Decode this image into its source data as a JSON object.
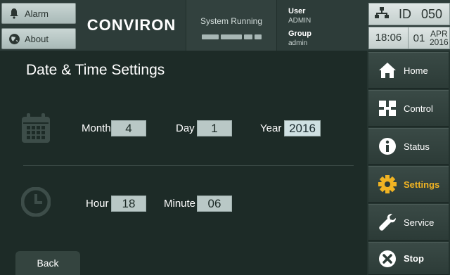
{
  "header": {
    "alarm_label": "Alarm",
    "about_label": "About",
    "brand": "CONVIRON",
    "system_status": "System Running",
    "user_label": "User",
    "user_value": "ADMIN",
    "group_label": "Group",
    "group_value": "admin",
    "id_label": "ID",
    "id_value": "050",
    "time": "18:06",
    "date_day": "01",
    "date_month": "APR",
    "date_year": "2016"
  },
  "main": {
    "title": "Date & Time Settings",
    "date": {
      "month_label": "Month",
      "month_value": "4",
      "day_label": "Day",
      "day_value": "1",
      "year_label": "Year",
      "year_value": "2016"
    },
    "time": {
      "hour_label": "Hour",
      "hour_value": "18",
      "minute_label": "Minute",
      "minute_value": "06"
    },
    "back_label": "Back"
  },
  "nav": {
    "items": [
      {
        "label": "Home",
        "icon": "home-icon"
      },
      {
        "label": "Control",
        "icon": "control-icon"
      },
      {
        "label": "Status",
        "icon": "info-icon"
      },
      {
        "label": "Settings",
        "icon": "gear-icon",
        "active": true
      },
      {
        "label": "Service",
        "icon": "wrench-icon"
      },
      {
        "label": "Stop",
        "icon": "stop-icon"
      }
    ]
  },
  "colors": {
    "background": "#1d2b27",
    "active_nav": "#f0b323",
    "field_bg": "#b9c8c6"
  }
}
